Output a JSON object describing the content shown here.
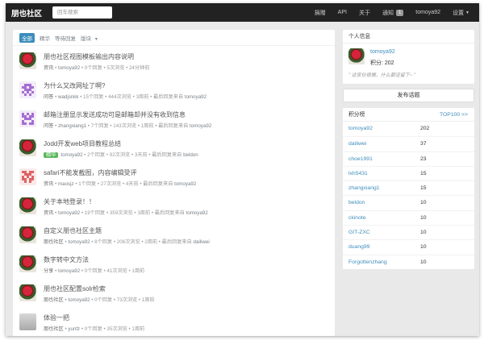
{
  "header": {
    "brand": "朋也社区",
    "search_placeholder": "回车搜索",
    "nav": {
      "donate": "捐赠",
      "api": "API",
      "about": "关于",
      "notify": "通知",
      "notify_count": "1",
      "user": "tomoya92",
      "settings": "设置",
      "settings_caret": "▼"
    }
  },
  "tabs": [
    {
      "label": "全部",
      "active": true
    },
    {
      "label": "精华",
      "active": false
    },
    {
      "label": "等待回复",
      "active": false
    },
    {
      "label": "版块",
      "caret": "▼"
    }
  ],
  "topics": [
    {
      "avatar": "rose",
      "title": "朋也社区视图模板输出内容说明",
      "node": "资讯",
      "meta": "tomoya92",
      "rest": " • 0个回复 • 5次浏览 • 24分钟前"
    },
    {
      "avatar": "purple",
      "title": "为什么又改网址了啊?",
      "node": "问答",
      "meta": "wadjsnkk",
      "rest": " • 15个回复 • 444次浏览 • 3周前 • 最后回复来自 ",
      "last": "tomoya92"
    },
    {
      "avatar": "purple2",
      "title": "邮箱注册显示发送成功可是邮箱却并没有收到信息",
      "node": "问答",
      "meta": "zhangxiang1",
      "rest": " • 7个回复 • 143次浏览 • 1周前 • 最后回复来自 ",
      "last": "tomoya92"
    },
    {
      "avatar": "rose",
      "title": "Jodd开发web项目教程总结",
      "good": "精华",
      "meta": "tomoya92",
      "rest": " • 2个回复 • 92次浏览 • 3天前 • 最后回复来自 ",
      "last": "beldon"
    },
    {
      "avatar": "pink",
      "title": "safari不能发截图，内容编辑受评",
      "node": "资讯",
      "meta": "maosjz",
      "rest": " • 1个回复 • 27次浏览 • 4天前 • 最后回复来自 ",
      "last": "tomoya92"
    },
    {
      "avatar": "rose",
      "title": "关于本地登录！！",
      "node": "资讯",
      "meta": "tomoya92",
      "rest": " • 19个回复 • 359次浏览 • 3周前 • 最后回复来自 ",
      "last": "tomoya92"
    },
    {
      "avatar": "rose",
      "title": "自定义朋也社区主题",
      "node": "朋也社区",
      "meta": "tomoya92",
      "rest": " • 8个回复 • 206次浏览 • 2周前 • 最后回复来自 ",
      "last": "dailiwei"
    },
    {
      "avatar": "rose",
      "title": "数字转中文方法",
      "node": "分享",
      "meta": "tomoya92",
      "rest": " • 0个回复 • 41次浏览 • 1周前"
    },
    {
      "avatar": "rose",
      "title": "朋也社区配置solr检索",
      "node": "朋也社区",
      "meta": "tomoya92",
      "rest": " • 0个回复 • 73次浏览 • 1周前"
    },
    {
      "avatar": "gray",
      "title": "体验一把",
      "node": "朋也社区",
      "meta": "yunfz",
      "rest": " • 0个回复 • 35次浏览 • 1周前"
    }
  ],
  "profile": {
    "heading": "个人信息",
    "username": "tomoya92",
    "score": "积分: 202",
    "signature": "\" 这家伙很懒，什么都没留下~ \""
  },
  "post_button": "发布话题",
  "ranking": {
    "heading": "积分榜",
    "more": "TOP100 >>",
    "rows": [
      {
        "name": "tomoya92",
        "score": "202"
      },
      {
        "name": "dailiwei",
        "score": "37"
      },
      {
        "name": "choe1991",
        "score": "23"
      },
      {
        "name": "lxh5431",
        "score": "15"
      },
      {
        "name": "zhangxiang1",
        "score": "15"
      },
      {
        "name": "beldon",
        "score": "10"
      },
      {
        "name": "ckinote",
        "score": "10"
      },
      {
        "name": "GIT-ZXC",
        "score": "10"
      },
      {
        "name": "duang99",
        "score": "10"
      },
      {
        "name": "Forgottenzhang",
        "score": "10"
      }
    ]
  },
  "colors": {
    "navbar": "#222222",
    "link": "#3c8dbc",
    "good": "#5cb85c",
    "avatar_purple": "#a66dd2",
    "avatar_pink": "#e06363"
  }
}
